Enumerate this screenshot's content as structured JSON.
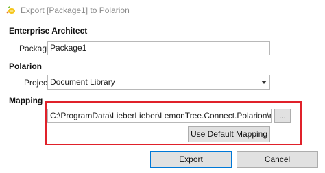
{
  "window": {
    "title": "Export [Package1] to Polarion"
  },
  "enterprise_architect": {
    "heading": "Enterprise Architect",
    "package_label": "Package:",
    "package_value": "Package1"
  },
  "polarion": {
    "heading": "Polarion",
    "project_label": "Project:",
    "project_value": "Document Library"
  },
  "mapping": {
    "heading": "Mapping",
    "path_value": "C:\\ProgramData\\LieberLieber\\LemonTree.Connect.Polarion\\mapping\\Polarion",
    "browse_label": "...",
    "default_mapping_label": "Use Default Mapping"
  },
  "actions": {
    "export_label": "Export",
    "cancel_label": "Cancel"
  },
  "colors": {
    "highlight": "#e0212a",
    "accent": "#0078d7"
  },
  "icons": {
    "app": "lemon-tree-app-icon",
    "dropdown": "chevron-down-icon"
  }
}
